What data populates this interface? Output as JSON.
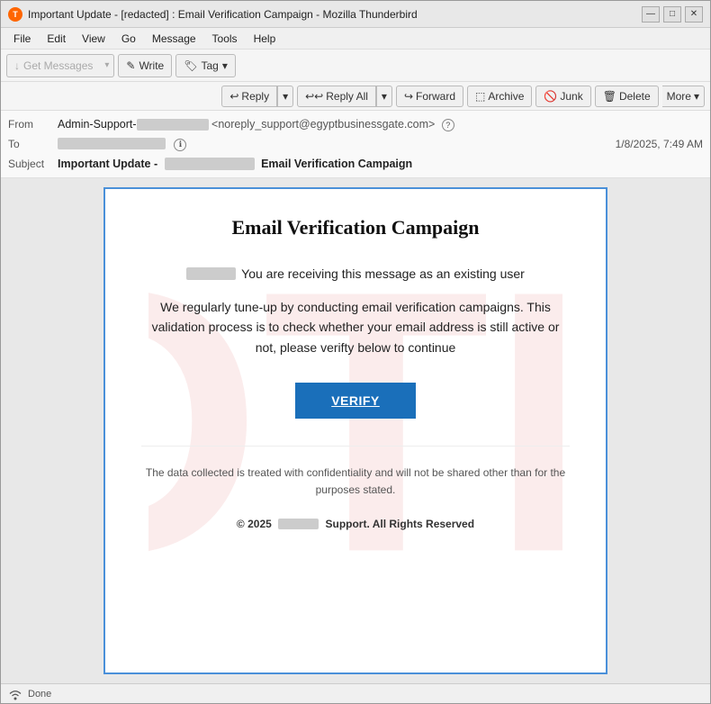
{
  "window": {
    "title": "Important Update - [redacted] : Email Verification Campaign - Mozilla Thunderbird",
    "title_short": "Important Update - [redacted] : Email Verification Campaign - Mozilla Thunderbird"
  },
  "menu": {
    "items": [
      "File",
      "Edit",
      "View",
      "Go",
      "Message",
      "Tools",
      "Help"
    ]
  },
  "toolbar": {
    "get_messages": "Get Messages",
    "write": "Write",
    "tag": "Tag"
  },
  "action_toolbar": {
    "reply": "Reply",
    "reply_all": "Reply All",
    "forward": "Forward",
    "archive": "Archive",
    "junk": "Junk",
    "delete": "Delete",
    "more": "More"
  },
  "email_header": {
    "from_label": "From",
    "from_name": "Admin-Support-[redacted]",
    "from_email": "<noreply_support@egyptbusinessgate.com>",
    "to_label": "To",
    "to_value": "[redacted]",
    "date": "1/8/2025, 7:49 AM",
    "subject_label": "Subject",
    "subject_prefix": "Important Update -",
    "subject_redacted": "[redacted]",
    "subject_suffix": "Email Verification Campaign"
  },
  "email_body": {
    "title": "Email Verification Campaign",
    "greeting": "You are receiving this message as an existing user",
    "greeting_name": "[redacted]",
    "paragraph": "We regularly tune-up by conducting email verification campaigns. This validation process is to check whether your email address is still active or not, please verifty below to continue",
    "verify_button": "VERIFY",
    "disclaimer": "The data collected is treated with confidentiality and will not be shared  other  than for the purposes stated.",
    "footer_copyright": "© 2025",
    "footer_redacted": "[redacted]",
    "footer_text": "Support. All Rights Reserved"
  },
  "status_bar": {
    "text": "Done"
  },
  "icons": {
    "thunderbird": "🦅",
    "minimize": "—",
    "maximize": "□",
    "close": "✕",
    "reply_arrow": "↩",
    "reply_all_arrow": "↩↩",
    "forward_arrow": "↪",
    "archive_box": "⬚",
    "junk_bin": "🗑",
    "delete_trash": "🗑",
    "chevron_down": "▾",
    "security": "?",
    "write_pencil": "✎",
    "tag_icon": "🏷",
    "get_messages_arrow": "↓",
    "wifi": "((·))"
  }
}
